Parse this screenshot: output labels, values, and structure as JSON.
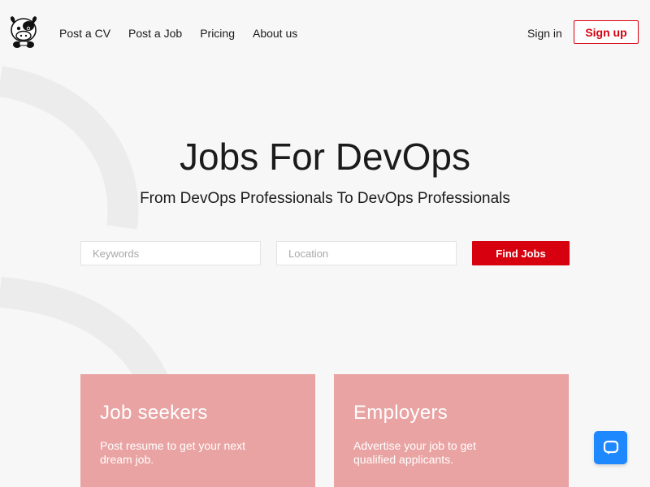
{
  "header": {
    "logo_name": "cow-mascot-logo",
    "nav": [
      {
        "label": "Post a CV"
      },
      {
        "label": "Post a Job"
      },
      {
        "label": "Pricing"
      },
      {
        "label": "About us"
      }
    ],
    "signin_label": "Sign in",
    "signup_label": "Sign up"
  },
  "hero": {
    "title": "Jobs For DevOps",
    "subtitle": "From DevOps Professionals To DevOps Professionals"
  },
  "search": {
    "keywords_placeholder": "Keywords",
    "keywords_value": "",
    "location_placeholder": "Location",
    "location_value": "",
    "button_label": "Find Jobs"
  },
  "cards": {
    "seekers": {
      "title": "Job seekers",
      "text": "Post resume to get your next dream job."
    },
    "employers": {
      "title": "Employers",
      "text": "Advertise your job to get qualified applicants."
    }
  },
  "chat": {
    "icon": "chat-bubble-icon"
  },
  "colors": {
    "brand_red": "#d7000f",
    "card_pink": "#e9a3a3",
    "chat_blue": "#1e88ff",
    "background": "#f7f7f7"
  }
}
